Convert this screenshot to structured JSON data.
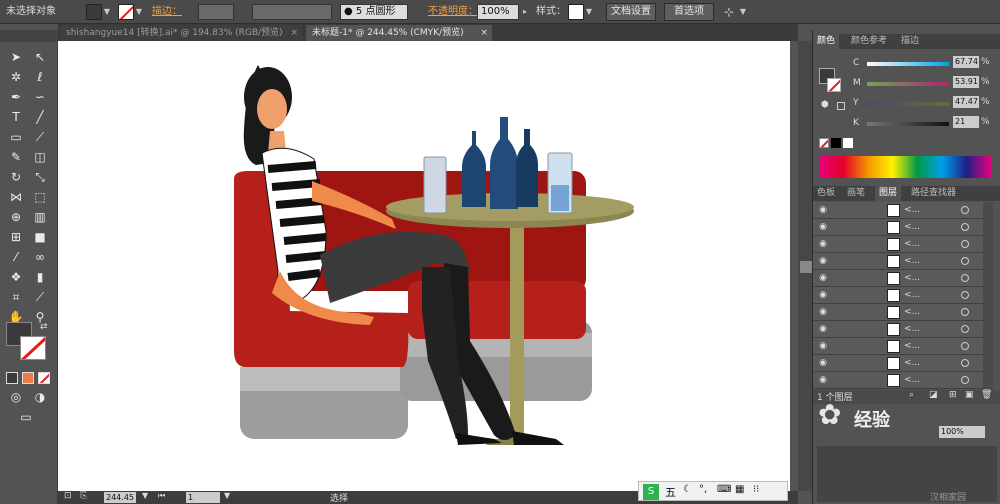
{
  "control_bar": {
    "selection_status": "未选择对象",
    "stroke_label": "描边：",
    "brush_label": "5 点圆形",
    "opacity_label": "不透明度：",
    "opacity_value": "100%",
    "style_label": "样式：",
    "doc_setup_button": "文档设置",
    "prefs_button": "首选项"
  },
  "tabs": [
    {
      "label": "shishangyue14 [转换].ai* @ 194.83% (RGB/预览)",
      "close": "×",
      "active": false
    },
    {
      "label": "未标题-1* @ 244.45% (CMYK/预览)",
      "close": "×",
      "active": true
    }
  ],
  "status_bar": {
    "zoom": "244.45",
    "page": "1",
    "tool_name": "选择",
    "ime_text": "五"
  },
  "color_panel": {
    "tabs": [
      "颜色",
      "颜色参考",
      "描边"
    ],
    "channels": [
      {
        "label": "C",
        "value": "67.74"
      },
      {
        "label": "M",
        "value": "53.91"
      },
      {
        "label": "Y",
        "value": "47.47"
      },
      {
        "label": "K",
        "value": "21"
      }
    ],
    "percent_sign": "%"
  },
  "layers_panel": {
    "tabs": [
      "色板",
      "画笔",
      "图层",
      "路径查找器"
    ],
    "row_name": "<...",
    "rows": 11,
    "footer": "1 个图层"
  },
  "transparency_panel": {
    "value": "100%"
  },
  "watermark": {
    "text": "经验",
    "subtext": "汉相家园"
  },
  "colors": {
    "sofa_red": "#b5201b",
    "sofa_base": "#9e9e9e",
    "table_top": "#8c8752",
    "bottle_blue": "#1e4470",
    "skin": "#f08a4b",
    "hair": "#1a1a1a"
  }
}
